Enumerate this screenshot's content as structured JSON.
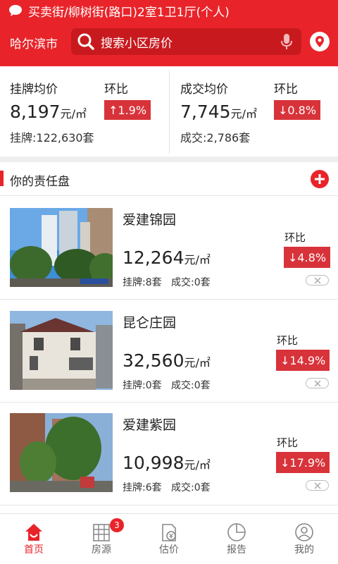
{
  "header": {
    "notice": "买卖街/柳树街(路口)2室1卫1厅(个人)",
    "city": "哈尔滨市",
    "search_placeholder": "搜索小区房价"
  },
  "stats": {
    "listing": {
      "label": "挂牌均价",
      "hb_label": "环比",
      "price": "8,197",
      "unit": "元/㎡",
      "change": "↑1.9%",
      "count": "挂牌:122,630套"
    },
    "deal": {
      "label": "成交均价",
      "hb_label": "环比",
      "price": "7,745",
      "unit": "元/㎡",
      "change": "↓0.8%",
      "count": "成交:2,786套"
    }
  },
  "section": {
    "title": "你的责任盘"
  },
  "listings": [
    {
      "name": "爱建锦园",
      "price": "12,264",
      "unit": "元/㎡",
      "listed": "挂牌:8套",
      "sold": "成交:0套",
      "hb_label": "环比",
      "change": "↓4.8%"
    },
    {
      "name": "昆仑庄园",
      "price": "32,560",
      "unit": "元/㎡",
      "listed": "挂牌:0套",
      "sold": "成交:0套",
      "hb_label": "环比",
      "change": "↓14.9%"
    },
    {
      "name": "爱建紫园",
      "price": "10,998",
      "unit": "元/㎡",
      "listed": "挂牌:6套",
      "sold": "成交:0套",
      "hb_label": "环比",
      "change": "↓17.9%"
    }
  ],
  "tabs": [
    {
      "label": "首页",
      "icon": "home-icon",
      "active": true
    },
    {
      "label": "房源",
      "icon": "building-icon",
      "badge": "3"
    },
    {
      "label": "估价",
      "icon": "valuation-icon"
    },
    {
      "label": "报告",
      "icon": "report-chart-icon"
    },
    {
      "label": "我的",
      "icon": "profile-icon"
    }
  ],
  "colors": {
    "brand_red": "#e8242a",
    "badge_red": "#d8333a"
  }
}
